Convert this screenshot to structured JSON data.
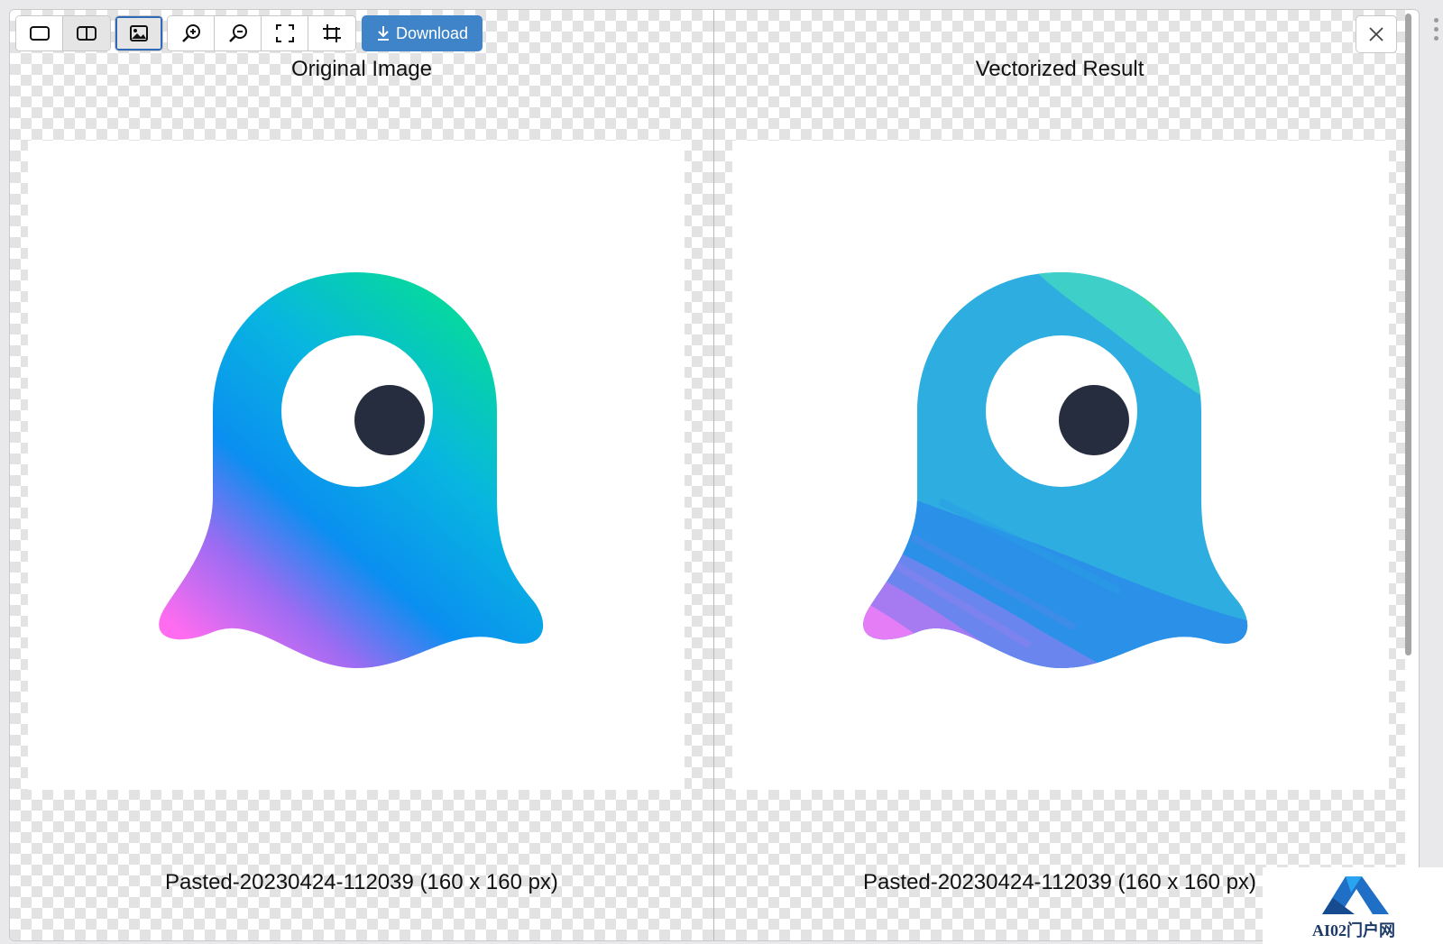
{
  "toolbar": {
    "buttons": [
      {
        "icon": "single-view-icon"
      },
      {
        "icon": "split-view-icon"
      },
      {
        "icon": "image-view-icon"
      },
      {
        "icon": "zoom-in-icon"
      },
      {
        "icon": "zoom-out-icon"
      },
      {
        "icon": "fit-screen-icon"
      },
      {
        "icon": "crop-icon"
      }
    ],
    "download_label": "Download"
  },
  "left_pane": {
    "title": "Original Image",
    "caption": "Pasted-20230424-112039 (160 x 160 px)"
  },
  "right_pane": {
    "title": "Vectorized Result",
    "caption": "Pasted-20230424-112039 (160 x 160 px)"
  },
  "watermark": {
    "text": "AI02门户网"
  },
  "colors": {
    "accent": "#3f84c8",
    "active_outline": "#2f6ab8",
    "eye_pupil": "#262d3f"
  }
}
